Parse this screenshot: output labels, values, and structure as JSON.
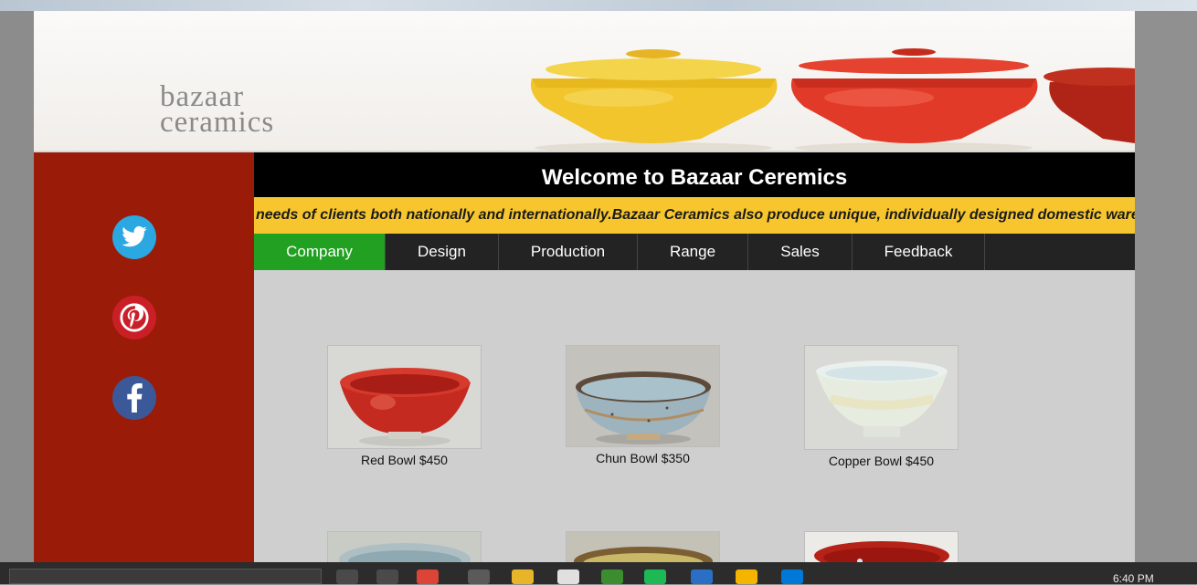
{
  "logo": {
    "line1": "bazaar",
    "line2": "ceramics"
  },
  "header": {
    "welcome": "Welcome to Bazaar Ceremics"
  },
  "marquee": {
    "text": "needs of clients both nationally and internationally.Bazaar Ceramics also produce unique, individually designed domestic ware"
  },
  "nav": {
    "items": [
      {
        "label": "Company",
        "width": 144,
        "active": true
      },
      {
        "label": "Design",
        "width": 124
      },
      {
        "label": "Production",
        "width": 152
      },
      {
        "label": "Range",
        "width": 121
      },
      {
        "label": "Sales",
        "width": 114
      },
      {
        "label": "Feedback",
        "width": 145
      }
    ]
  },
  "social": [
    {
      "name": "twitter-icon",
      "color": "#2ba7e1"
    },
    {
      "name": "pinterest-icon",
      "color": "#cb1f27"
    },
    {
      "name": "facebook-icon",
      "color": "#3b5998"
    }
  ],
  "products": [
    {
      "caption": "Red Bowl $450"
    },
    {
      "caption": "Chun Bowl $350"
    },
    {
      "caption": "Copper Bowl $450"
    },
    {
      "caption": ""
    },
    {
      "caption": ""
    },
    {
      "caption": ""
    }
  ],
  "taskbar": {
    "time": "6:40 PM"
  },
  "colors": {
    "accent": "#22a022",
    "sidebar": "#9a1b07",
    "marquee": "#f7c62e"
  }
}
